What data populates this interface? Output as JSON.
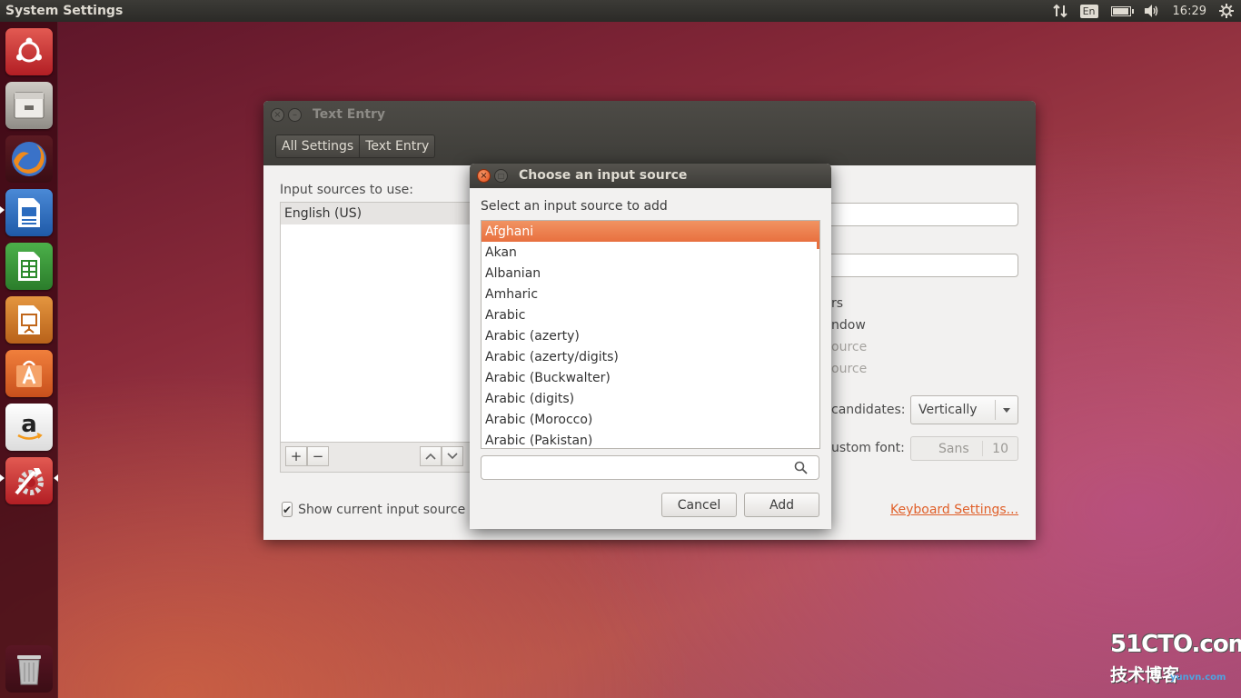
{
  "top_panel": {
    "app_title": "System Settings",
    "keyboard_indicator": "En",
    "battery_level": 0.85,
    "clock": "16:29",
    "icons": [
      "network-arrows-icon",
      "keyboard-indicator",
      "battery-icon",
      "volume-icon",
      "clock",
      "power-gear-icon"
    ]
  },
  "launcher": {
    "items": [
      "ubuntu-dash-icon",
      "files-icon",
      "firefox-icon",
      "libreoffice-writer-icon",
      "libreoffice-calc-icon",
      "libreoffice-impress-icon",
      "software-center-icon",
      "amazon-icon",
      "system-settings-icon",
      "trash-icon"
    ]
  },
  "text_entry_window": {
    "title": "Text Entry",
    "breadcrumb": [
      "All Settings",
      "Text Entry"
    ],
    "sources_label": "Input sources to use:",
    "sources": [
      "English (US)"
    ],
    "toolbar": {
      "add": "+",
      "remove": "−"
    },
    "show_current_source": "Show current input source in the menu bar",
    "right_labels": {
      "switch_fragment": "rs",
      "window_fragment": "ndow",
      "source1_fragment": "ource",
      "source2_fragment": "ource",
      "candidates_fragment": "candidates:",
      "font_fragment": "ustom font:"
    },
    "candidates_value": "Vertically",
    "font_name": "Sans",
    "font_size": "10",
    "keyboard_settings_link": "Keyboard Settings..."
  },
  "dialog": {
    "title": "Choose an input source",
    "prompt": "Select an input source to add",
    "layouts": [
      "Afghani",
      "Akan",
      "Albanian",
      "Amharic",
      "Arabic",
      "Arabic (azerty)",
      "Arabic (azerty/digits)",
      "Arabic (Buckwalter)",
      "Arabic (digits)",
      "Arabic (Morocco)",
      "Arabic (Pakistan)"
    ],
    "selected": "Afghani",
    "search_value": "",
    "cancel_label": "Cancel",
    "add_label": "Add"
  },
  "watermark": {
    "top": "51CTO.com",
    "bottom": "技术博客",
    "sub": "yunvn.com"
  },
  "colors": {
    "accent": "#e8703f",
    "link": "#e0602a",
    "panel": "#3c3b37"
  }
}
